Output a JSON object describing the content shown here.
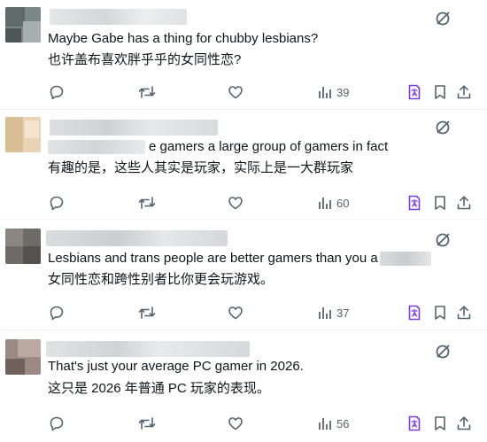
{
  "tweets": [
    {
      "text_en": "Maybe Gabe has a thing for chubby lesbians?",
      "text_zh": "也许盖布喜欢胖乎乎的女同性恋?",
      "views": "39"
    },
    {
      "text_en": "e gamers a large group of gamers in fact",
      "text_zh": "有趣的是，这些人其实是玩家，实际上是一大群玩家",
      "views": "60"
    },
    {
      "text_en": "Lesbians and trans people are better gamers than you a",
      "text_zh": "女同性恋和跨性别者比你更会玩游戏。",
      "views": "37"
    },
    {
      "text_en": "That's just your average PC gamer in 2026.",
      "text_zh": "这只是 2026 年普通 PC 玩家的表现。",
      "views": "56"
    }
  ],
  "colors": {
    "icon_gray": "#536471",
    "grok_purple": "#7c3aed",
    "divider": "#eff3f4"
  },
  "icons": [
    "reply-icon",
    "retweet-icon",
    "like-icon",
    "views-icon",
    "grok-translate-icon",
    "bookmark-icon",
    "share-icon",
    "grok-icon"
  ]
}
